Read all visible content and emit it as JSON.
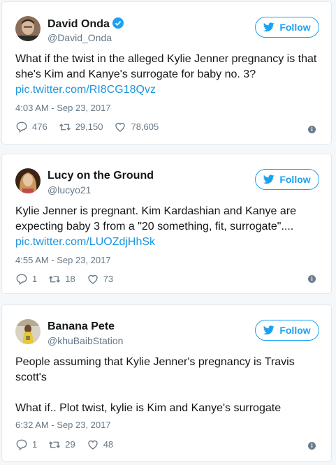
{
  "accent_color": "#1da1f2",
  "link_color": "#1b95e0",
  "tweets": [
    {
      "name": "David Onda",
      "verified": true,
      "handle": "@David_Onda",
      "follow_label": "Follow",
      "text": "What if the twist in the alleged Kylie Jenner pregnancy is that she's Kim and Kanye's surrogate for baby no. 3?",
      "link": "pic.twitter.com/RI8CG18Qvz",
      "timestamp": "4:03 AM - Sep 23, 2017",
      "replies": "476",
      "retweets": "29,150",
      "likes": "78,605"
    },
    {
      "name": "Lucy on the Ground",
      "verified": false,
      "handle": "@lucyo21",
      "follow_label": "Follow",
      "text": "Kylie Jenner is pregnant. Kim Kardashian and Kanye are expecting baby 3 from a \"20 something, fit, surrogate\"....",
      "link": "pic.twitter.com/LUOZdjHhSk",
      "timestamp": "4:55 AM - Sep 23, 2017",
      "replies": "1",
      "retweets": "18",
      "likes": "73"
    },
    {
      "name": "Banana Pete",
      "verified": false,
      "handle": "@khuBaibStation",
      "follow_label": "Follow",
      "text_line1": "People assuming that Kylie Jenner's pregnancy is Travis scott's",
      "text_line2": "What if.. Plot twist, kylie is Kim and Kanye's surrogate",
      "timestamp": "6:32 AM - Sep 23, 2017",
      "replies": "1",
      "retweets": "29",
      "likes": "48"
    }
  ]
}
